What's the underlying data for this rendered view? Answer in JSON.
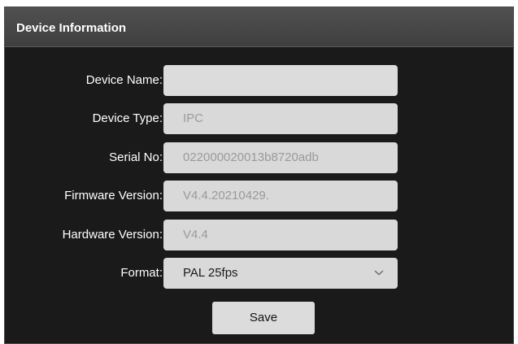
{
  "panel": {
    "title": "Device Information"
  },
  "form": {
    "device_name": {
      "label": "Device Name:",
      "value": ""
    },
    "device_type": {
      "label": "Device Type:",
      "value": "IPC"
    },
    "serial_no": {
      "label": "Serial No:",
      "value": "022000020013b8720adb"
    },
    "firmware_version": {
      "label": "Firmware Version:",
      "value": "V4.4.20210429."
    },
    "hardware_version": {
      "label": "Hardware Version:",
      "value": "V4.4"
    },
    "format": {
      "label": "Format:",
      "value": "PAL 25fps",
      "icon": "chevron-down-icon"
    }
  },
  "actions": {
    "save_label": "Save"
  },
  "colors": {
    "panel_background": "#1a1a1a",
    "header_background": "#474747",
    "field_background": "#d9d9d9",
    "readonly_text": "#9a9a9a"
  }
}
